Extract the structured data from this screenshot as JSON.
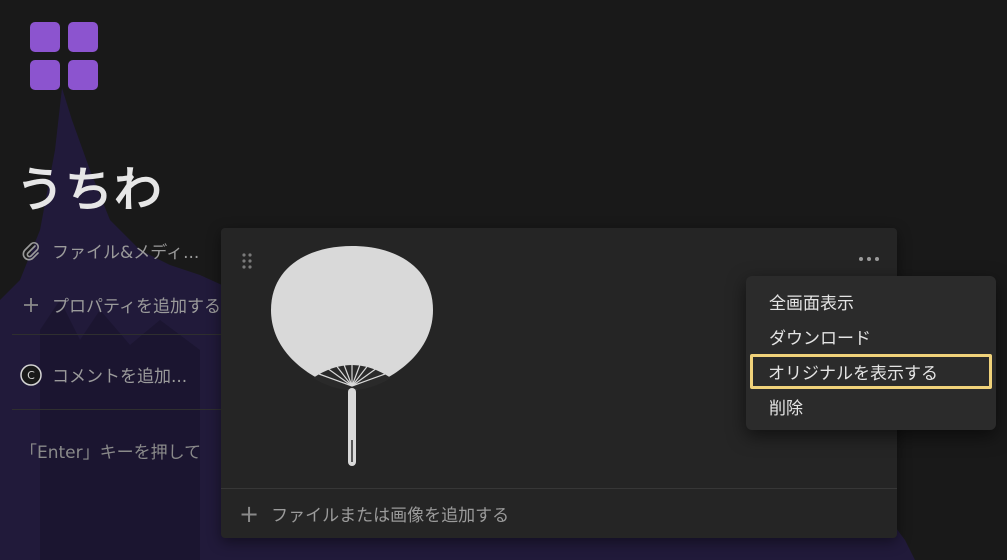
{
  "page": {
    "title": "うちわ"
  },
  "properties": {
    "files_label": "ファイル&メディ...",
    "add_property": "プロパティを追加する",
    "add_comment": "コメントを追加...",
    "hint": "「Enter」キーを押して"
  },
  "media": {
    "add_file": "ファイルまたは画像を追加する"
  },
  "context_menu": {
    "items": [
      "全画面表示",
      "ダウンロード",
      "オリジナルを表示する",
      "削除"
    ]
  },
  "colors": {
    "accent_purple": "#8c54cf",
    "highlight_outline": "#f0d27a",
    "mountain": "#211a3a"
  }
}
